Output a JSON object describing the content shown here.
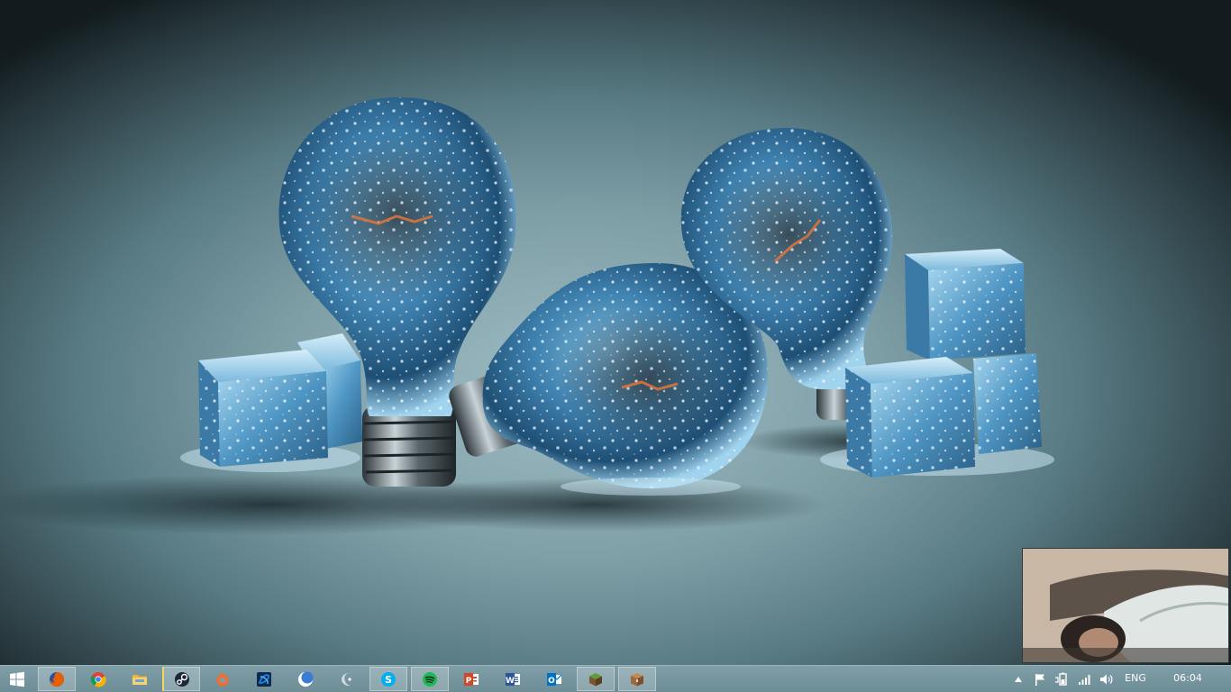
{
  "taskbar": {
    "apps": [
      {
        "id": "firefox",
        "icon": "firefox-icon",
        "color": "#e66000"
      },
      {
        "id": "chrome",
        "icon": "chrome-icon",
        "color": "#db4437"
      },
      {
        "id": "file-explorer",
        "icon": "folder-icon",
        "color": "#f4c550"
      },
      {
        "id": "steam",
        "icon": "steam-icon",
        "color": "#1b2838"
      },
      {
        "id": "origin",
        "icon": "origin-icon",
        "color": "#f56c2d"
      },
      {
        "id": "battlenet",
        "icon": "battlenet-icon",
        "color": "#148eff"
      },
      {
        "id": "app-moon",
        "icon": "moon-icon",
        "color": "#3a7bd5"
      },
      {
        "id": "app-crescent",
        "icon": "crescent-icon",
        "color": "#cfd8dc"
      },
      {
        "id": "skype",
        "icon": "skype-icon",
        "color": "#00aff0"
      },
      {
        "id": "spotify",
        "icon": "spotify-icon",
        "color": "#1db954"
      },
      {
        "id": "powerpoint",
        "icon": "powerpoint-icon",
        "color": "#d24726"
      },
      {
        "id": "word",
        "icon": "word-icon",
        "color": "#2b579a"
      },
      {
        "id": "outlook",
        "icon": "outlook-icon",
        "color": "#0072c6"
      },
      {
        "id": "minecraft",
        "icon": "minecraft-icon",
        "color": "#5d9c3a"
      },
      {
        "id": "minecraft-launcher",
        "icon": "chest-icon",
        "color": "#9b6a3c"
      }
    ],
    "tray": {
      "language": "ENG",
      "time": "06:04"
    }
  }
}
